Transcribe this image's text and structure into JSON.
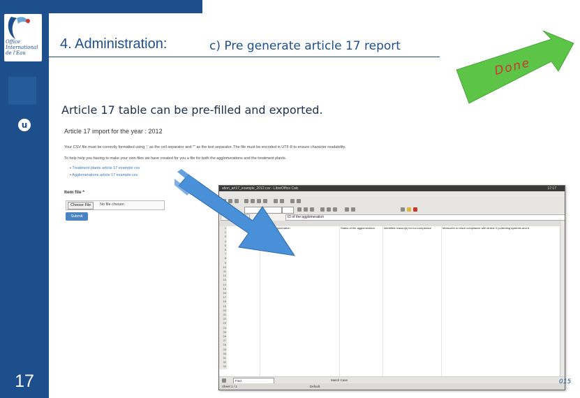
{
  "slide": {
    "title": "4. Administration:",
    "subtitle_part": "c) Pre generate article 17 report",
    "description": "Article 17 table can be pre-filled and exported.",
    "done_label": "Done",
    "page_number": "17",
    "footer_fragment": "015",
    "logo_text": [
      "Office",
      "International",
      "de l'Eau"
    ],
    "badge": "u",
    "colors": {
      "brand": "#1c4f8c",
      "done_arrow": "#5cc447",
      "done_text": "#d0342c",
      "pointer_arrow": "#4a90d9"
    }
  },
  "webpage": {
    "heading": "Article 17 import for the year : 2012",
    "instruction_format": "Your CSV file must be correctly formatted using ';' as the cell separator and '\"' as the text separator. The file must be encoded in UTF-8 to ensure character readability.",
    "instruction_help": "To help help you having to make your own files we have created for you a file for both the agglomerations and the treatment plants.",
    "links": [
      "Treatment plants article 17 example csv",
      "Agglomerations article 17 example csv"
    ],
    "form_label": "Item file *",
    "choose_button": "Choose File",
    "no_file": "No file chosen",
    "submit_button": "Submit"
  },
  "calc": {
    "window_title": "ation_art17_example_2012.csv - LibreOffice Calc",
    "clock": "17:17",
    "font_name": "",
    "font_size": "",
    "formula": "ID of the agglomeration",
    "headers": [
      "",
      "ID of the agglomeration",
      "Status of the agglomeration",
      "Identified reason(s) for not compliance",
      "Measures to reach compliance with Article 3 (collecting systems and A"
    ],
    "rows": [
      [
        "2",
        "",
        ""
      ],
      [
        "3",
        "",
        ""
      ],
      [
        "4",
        "",
        ""
      ],
      [
        "5",
        "",
        ""
      ],
      [
        "6",
        "",
        ""
      ],
      [
        "7",
        "",
        ""
      ],
      [
        "8",
        "",
        ""
      ],
      [
        "9",
        "",
        ""
      ],
      [
        "10",
        "",
        ""
      ],
      [
        "11",
        "",
        ""
      ],
      [
        "12",
        "",
        ""
      ],
      [
        "13",
        "",
        ""
      ],
      [
        "14",
        "",
        ""
      ],
      [
        "15",
        "",
        ""
      ],
      [
        "16",
        "",
        ""
      ],
      [
        "17",
        "",
        ""
      ],
      [
        "18",
        "",
        ""
      ],
      [
        "19",
        "",
        ""
      ],
      [
        "20",
        "",
        ""
      ],
      [
        "21",
        "",
        ""
      ],
      [
        "22",
        "",
        ""
      ],
      [
        "23",
        "",
        ""
      ],
      [
        "24",
        "",
        ""
      ],
      [
        "25",
        "",
        ""
      ],
      [
        "26",
        "",
        ""
      ],
      [
        "27",
        "",
        ""
      ],
      [
        "28",
        "",
        ""
      ],
      [
        "29",
        "",
        ""
      ],
      [
        "30",
        "",
        ""
      ],
      [
        "31",
        "",
        ""
      ],
      [
        "32",
        "",
        ""
      ],
      [
        "33",
        "",
        ""
      ]
    ],
    "sheet_tab": "Sheet1",
    "find_placeholder": "Find",
    "find_option": "Match Case",
    "status_sheet": "Sheet 1 / 1",
    "status_style": "Default"
  }
}
